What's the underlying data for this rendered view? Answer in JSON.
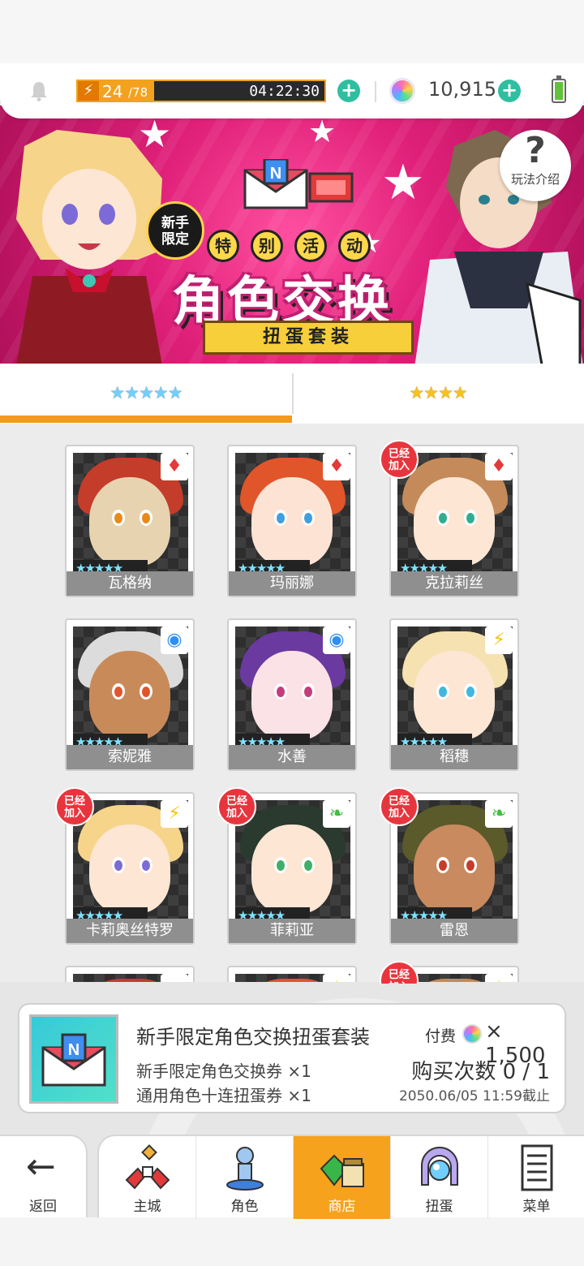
{
  "top_bar": {
    "stamina_current": "24",
    "stamina_max": "/78",
    "stamina_fraction": 0.31,
    "stamina_timer": "04:22:30",
    "gems": "10,915",
    "plus": "+"
  },
  "banner": {
    "badge_new": "新手\n限定",
    "tags": [
      "特",
      "别",
      "活",
      "动"
    ],
    "title": "角色交换",
    "ribbon": "扭蛋套装",
    "help_label": "玩法介绍",
    "help_symbol": "?"
  },
  "tabs": {
    "five_star": "★★★★★",
    "four_star": "★★★★"
  },
  "characters": [
    {
      "name": "瓦格纳",
      "element": "fire",
      "joined": false
    },
    {
      "name": "玛丽娜",
      "element": "fire",
      "joined": false
    },
    {
      "name": "克拉莉丝",
      "element": "fire",
      "joined": true
    },
    {
      "name": "索妮雅",
      "element": "water",
      "joined": false
    },
    {
      "name": "水善",
      "element": "water",
      "joined": false
    },
    {
      "name": "稻穗",
      "element": "thunder",
      "joined": false
    },
    {
      "name": "卡莉奥丝特罗",
      "element": "thunder",
      "joined": true
    },
    {
      "name": "菲莉亚",
      "element": "wind",
      "joined": true
    },
    {
      "name": "雷恩",
      "element": "wind",
      "joined": true
    }
  ],
  "joined_badge": "已经\n加入",
  "card_stars": "★★★★★",
  "purchase": {
    "title": "新手限定角色交换扭蛋套装",
    "paid_label": "付费",
    "price": "× 1,500",
    "item1": "新手限定角色交换券 ×1",
    "item2": "通用角色十连扭蛋券 ×1",
    "purchase_count": "购买次数 0 / 1",
    "deadline": "2050.06/05 11:59截止"
  },
  "nav": {
    "back": "返回",
    "items": [
      {
        "label": "主城",
        "active": false
      },
      {
        "label": "角色",
        "active": false
      },
      {
        "label": "商店",
        "active": true
      },
      {
        "label": "扭蛋",
        "active": false
      },
      {
        "label": "菜单",
        "active": false
      }
    ]
  },
  "colors": {
    "accent": "#f39a1b",
    "banner": "#e0207a",
    "joined_badge": "#e8353d",
    "plus": "#2fbfa0"
  }
}
